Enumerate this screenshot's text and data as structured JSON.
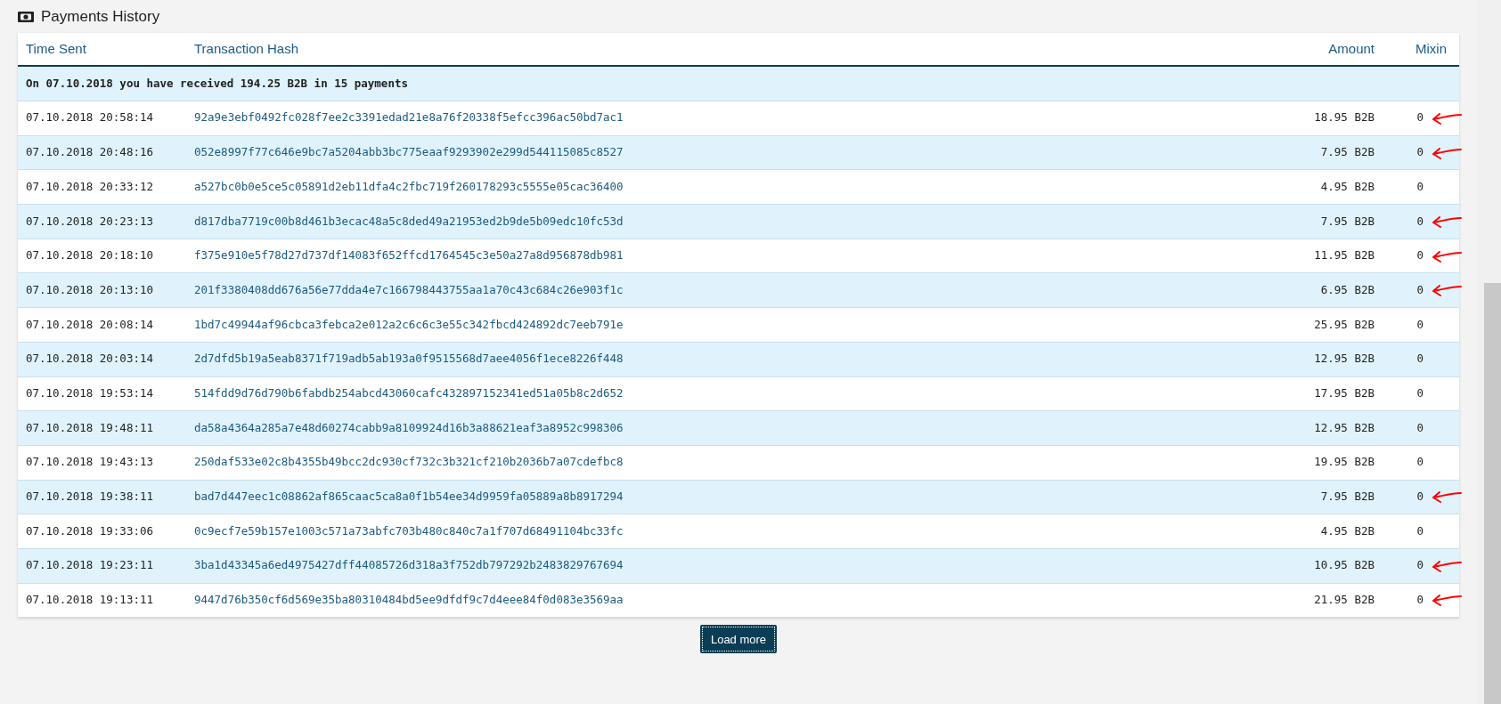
{
  "section_title": "Payments History",
  "table": {
    "columns": [
      "Time Sent",
      "Transaction Hash",
      "Amount",
      "Mixin"
    ],
    "summary": "On 07.10.2018 you have received 194.25 B2B in 15 payments",
    "rows": [
      {
        "time": "07.10.2018 20:58:14",
        "hash": "92a9e3ebf0492fc028f7ee2c3391edad21e8a76f20338f5efcc396ac50bd7ac1",
        "amount": "18.95 B2B",
        "mixin": "0",
        "marked": true
      },
      {
        "time": "07.10.2018 20:48:16",
        "hash": "052e8997f77c646e9bc7a5204abb3bc775eaaf9293902e299d544115085c8527",
        "amount": "7.95 B2B",
        "mixin": "0",
        "marked": true
      },
      {
        "time": "07.10.2018 20:33:12",
        "hash": "a527bc0b0e5ce5c05891d2eb11dfa4c2fbc719f260178293c5555e05cac36400",
        "amount": "4.95 B2B",
        "mixin": "0",
        "marked": false
      },
      {
        "time": "07.10.2018 20:23:13",
        "hash": "d817dba7719c00b8d461b3ecac48a5c8ded49a21953ed2b9de5b09edc10fc53d",
        "amount": "7.95 B2B",
        "mixin": "0",
        "marked": true
      },
      {
        "time": "07.10.2018 20:18:10",
        "hash": "f375e910e5f78d27d737df14083f652ffcd1764545c3e50a27a8d956878db981",
        "amount": "11.95 B2B",
        "mixin": "0",
        "marked": true
      },
      {
        "time": "07.10.2018 20:13:10",
        "hash": "201f3380408dd676a56e77dda4e7c166798443755aa1a70c43c684c26e903f1c",
        "amount": "6.95 B2B",
        "mixin": "0",
        "marked": true
      },
      {
        "time": "07.10.2018 20:08:14",
        "hash": "1bd7c49944af96cbca3febca2e012a2c6c6c3e55c342fbcd424892dc7eeb791e",
        "amount": "25.95 B2B",
        "mixin": "0",
        "marked": false
      },
      {
        "time": "07.10.2018 20:03:14",
        "hash": "2d7dfd5b19a5eab8371f719adb5ab193a0f9515568d7aee4056f1ece8226f448",
        "amount": "12.95 B2B",
        "mixin": "0",
        "marked": false
      },
      {
        "time": "07.10.2018 19:53:14",
        "hash": "514fdd9d76d790b6fabdb254abcd43060cafc432897152341ed51a05b8c2d652",
        "amount": "17.95 B2B",
        "mixin": "0",
        "marked": false
      },
      {
        "time": "07.10.2018 19:48:11",
        "hash": "da58a4364a285a7e48d60274cabb9a8109924d16b3a88621eaf3a8952c998306",
        "amount": "12.95 B2B",
        "mixin": "0",
        "marked": false
      },
      {
        "time": "07.10.2018 19:43:13",
        "hash": "250daf533e02c8b4355b49bcc2dc930cf732c3b321cf210b2036b7a07cdefbc8",
        "amount": "19.95 B2B",
        "mixin": "0",
        "marked": false
      },
      {
        "time": "07.10.2018 19:38:11",
        "hash": "bad7d447eec1c08862af865caac5ca8a0f1b54ee34d9959fa05889a8b8917294",
        "amount": "7.95 B2B",
        "mixin": "0",
        "marked": true
      },
      {
        "time": "07.10.2018 19:33:06",
        "hash": "0c9ecf7e59b157e1003c571a73abfc703b480c840c7a1f707d68491104bc33fc",
        "amount": "4.95 B2B",
        "mixin": "0",
        "marked": false
      },
      {
        "time": "07.10.2018 19:23:11",
        "hash": "3ba1d43345a6ed4975427dff44085726d318a3f752db797292b2483829767694",
        "amount": "10.95 B2B",
        "mixin": "0",
        "marked": true
      },
      {
        "time": "07.10.2018 19:13:11",
        "hash": "9447d76b350cf6d569e35ba80310484bd5ee9dfdf9c7d4eee84f0d083e3569aa",
        "amount": "21.95 B2B",
        "mixin": "0",
        "marked": true
      }
    ]
  },
  "load_more_button": "Load more"
}
